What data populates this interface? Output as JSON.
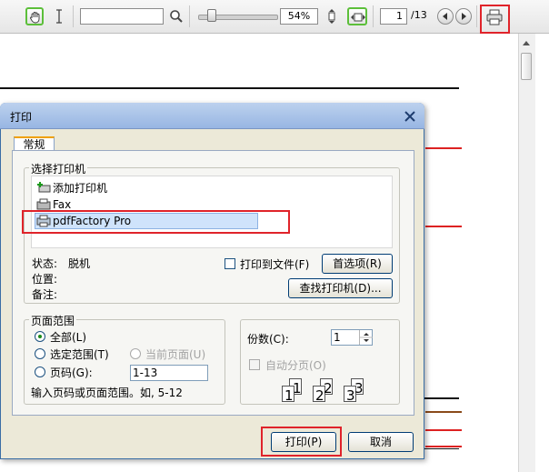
{
  "toolbar": {
    "zoom_value": "54%",
    "page_current": "1",
    "page_total": "/13",
    "icons": [
      "hand-tool-icon",
      "text-select-icon",
      "search-icon",
      "fit-height-icon",
      "fit-width-icon",
      "prev-page-icon",
      "next-page-icon",
      "printer-icon"
    ]
  },
  "dialog": {
    "title": "打印",
    "tab": "常规",
    "select_printer_label": "选择打印机",
    "printers": [
      {
        "name": "添加打印机",
        "icon": "add-printer-icon"
      },
      {
        "name": "Fax",
        "icon": "fax-icon"
      },
      {
        "name": "pdfFactory Pro",
        "icon": "printer-icon"
      }
    ],
    "status_label": "状态:",
    "status_value": "脱机",
    "location_label": "位置:",
    "comment_label": "备注:",
    "print_to_file": "打印到文件(F)",
    "preferences_button": "首选项(R)",
    "find_printer_button": "查找打印机(D)...",
    "page_range": {
      "label": "页面范围",
      "all": "全部(L)",
      "selection": "选定范围(T)",
      "current_page": "当前页面(U)",
      "pages": "页码(G):",
      "pages_value": "1-13",
      "hint": "输入页码或页面范围。如, 5-12"
    },
    "copies": {
      "label": "份数(C):",
      "value": "1",
      "collate": "自动分页(O)",
      "collate_digits": [
        "1",
        "1",
        "2",
        "2",
        "3",
        "3"
      ]
    },
    "print_button": "打印(P)",
    "cancel_button": "取消"
  },
  "colors": {
    "highlight_border": "#e0232a",
    "toolbar_accent": "#5cbf3a",
    "title_bar": "#98b6e3"
  }
}
